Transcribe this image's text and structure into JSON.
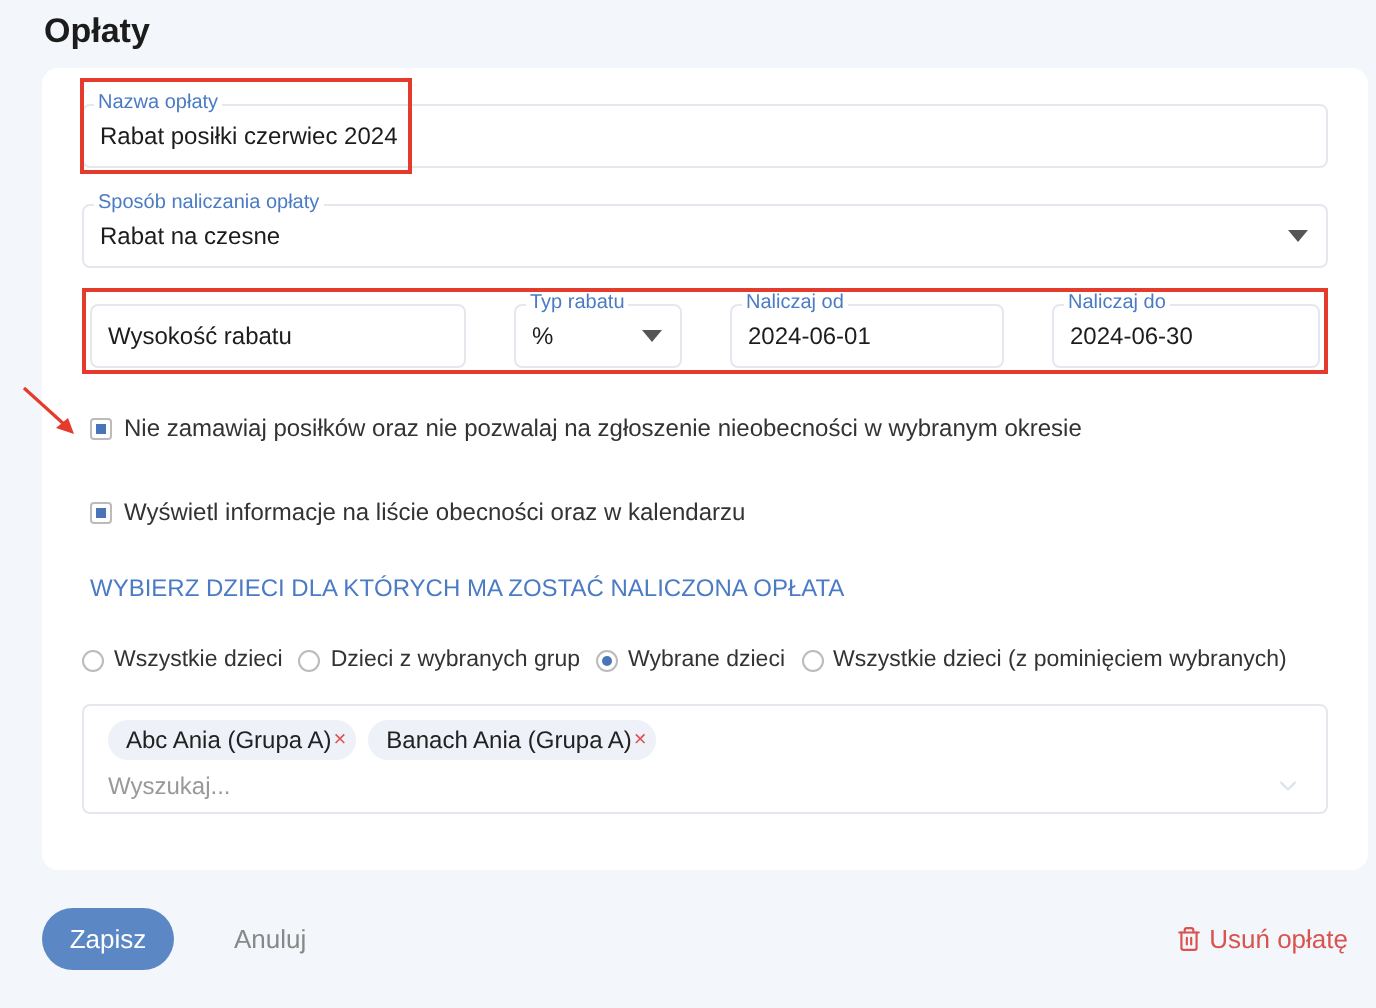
{
  "page": {
    "title": "Opłaty"
  },
  "form": {
    "fee_name": {
      "label": "Nazwa opłaty",
      "value": "Rabat posiłki czerwiec 2024",
      "highlighted": true
    },
    "method": {
      "label": "Sposób naliczania opłaty",
      "value": "Rabat na czesne"
    },
    "discount_row": {
      "highlighted": true,
      "fields": [
        {
          "kind": "text",
          "placeholder": "Wysokość rabatu"
        },
        {
          "kind": "select",
          "label": "Typ rabatu",
          "value": "%"
        },
        {
          "kind": "text",
          "label": "Naliczaj od",
          "value": "2024-06-01"
        },
        {
          "kind": "text",
          "label": "Naliczaj do",
          "value": "2024-06-30"
        }
      ]
    },
    "checkboxes": [
      {
        "label": "Nie zamawiaj posiłków oraz nie pozwalaj na zgłoszenie nieobecności w wybranym okresie",
        "checked": true,
        "pointed": true
      },
      {
        "label": "Wyświetl informacje na liście obecności oraz w kalendarzu",
        "checked": true,
        "pointed": false
      }
    ],
    "children_heading": "WYBIERZ DZIECI DLA KTÓRYCH MA ZOSTAĆ NALICZONA OPŁATA",
    "scope_options": [
      {
        "label": "Wszystkie dzieci",
        "selected": false
      },
      {
        "label": "Dzieci z wybranych grup",
        "selected": false
      },
      {
        "label": "Wybrane dzieci",
        "selected": true
      },
      {
        "label": "Wszystkie dzieci (z pominięciem wybranych)",
        "selected": false
      }
    ],
    "children": {
      "tags": [
        {
          "label": "Abc Ania (Grupa A)",
          "remove": "×"
        },
        {
          "label": "Banach Ania (Grupa A)",
          "remove": "×"
        }
      ],
      "placeholder": "Wyszukaj..."
    }
  },
  "actions": {
    "save": "Zapisz",
    "cancel": "Anuluj",
    "delete": "Usuń opłatę"
  }
}
